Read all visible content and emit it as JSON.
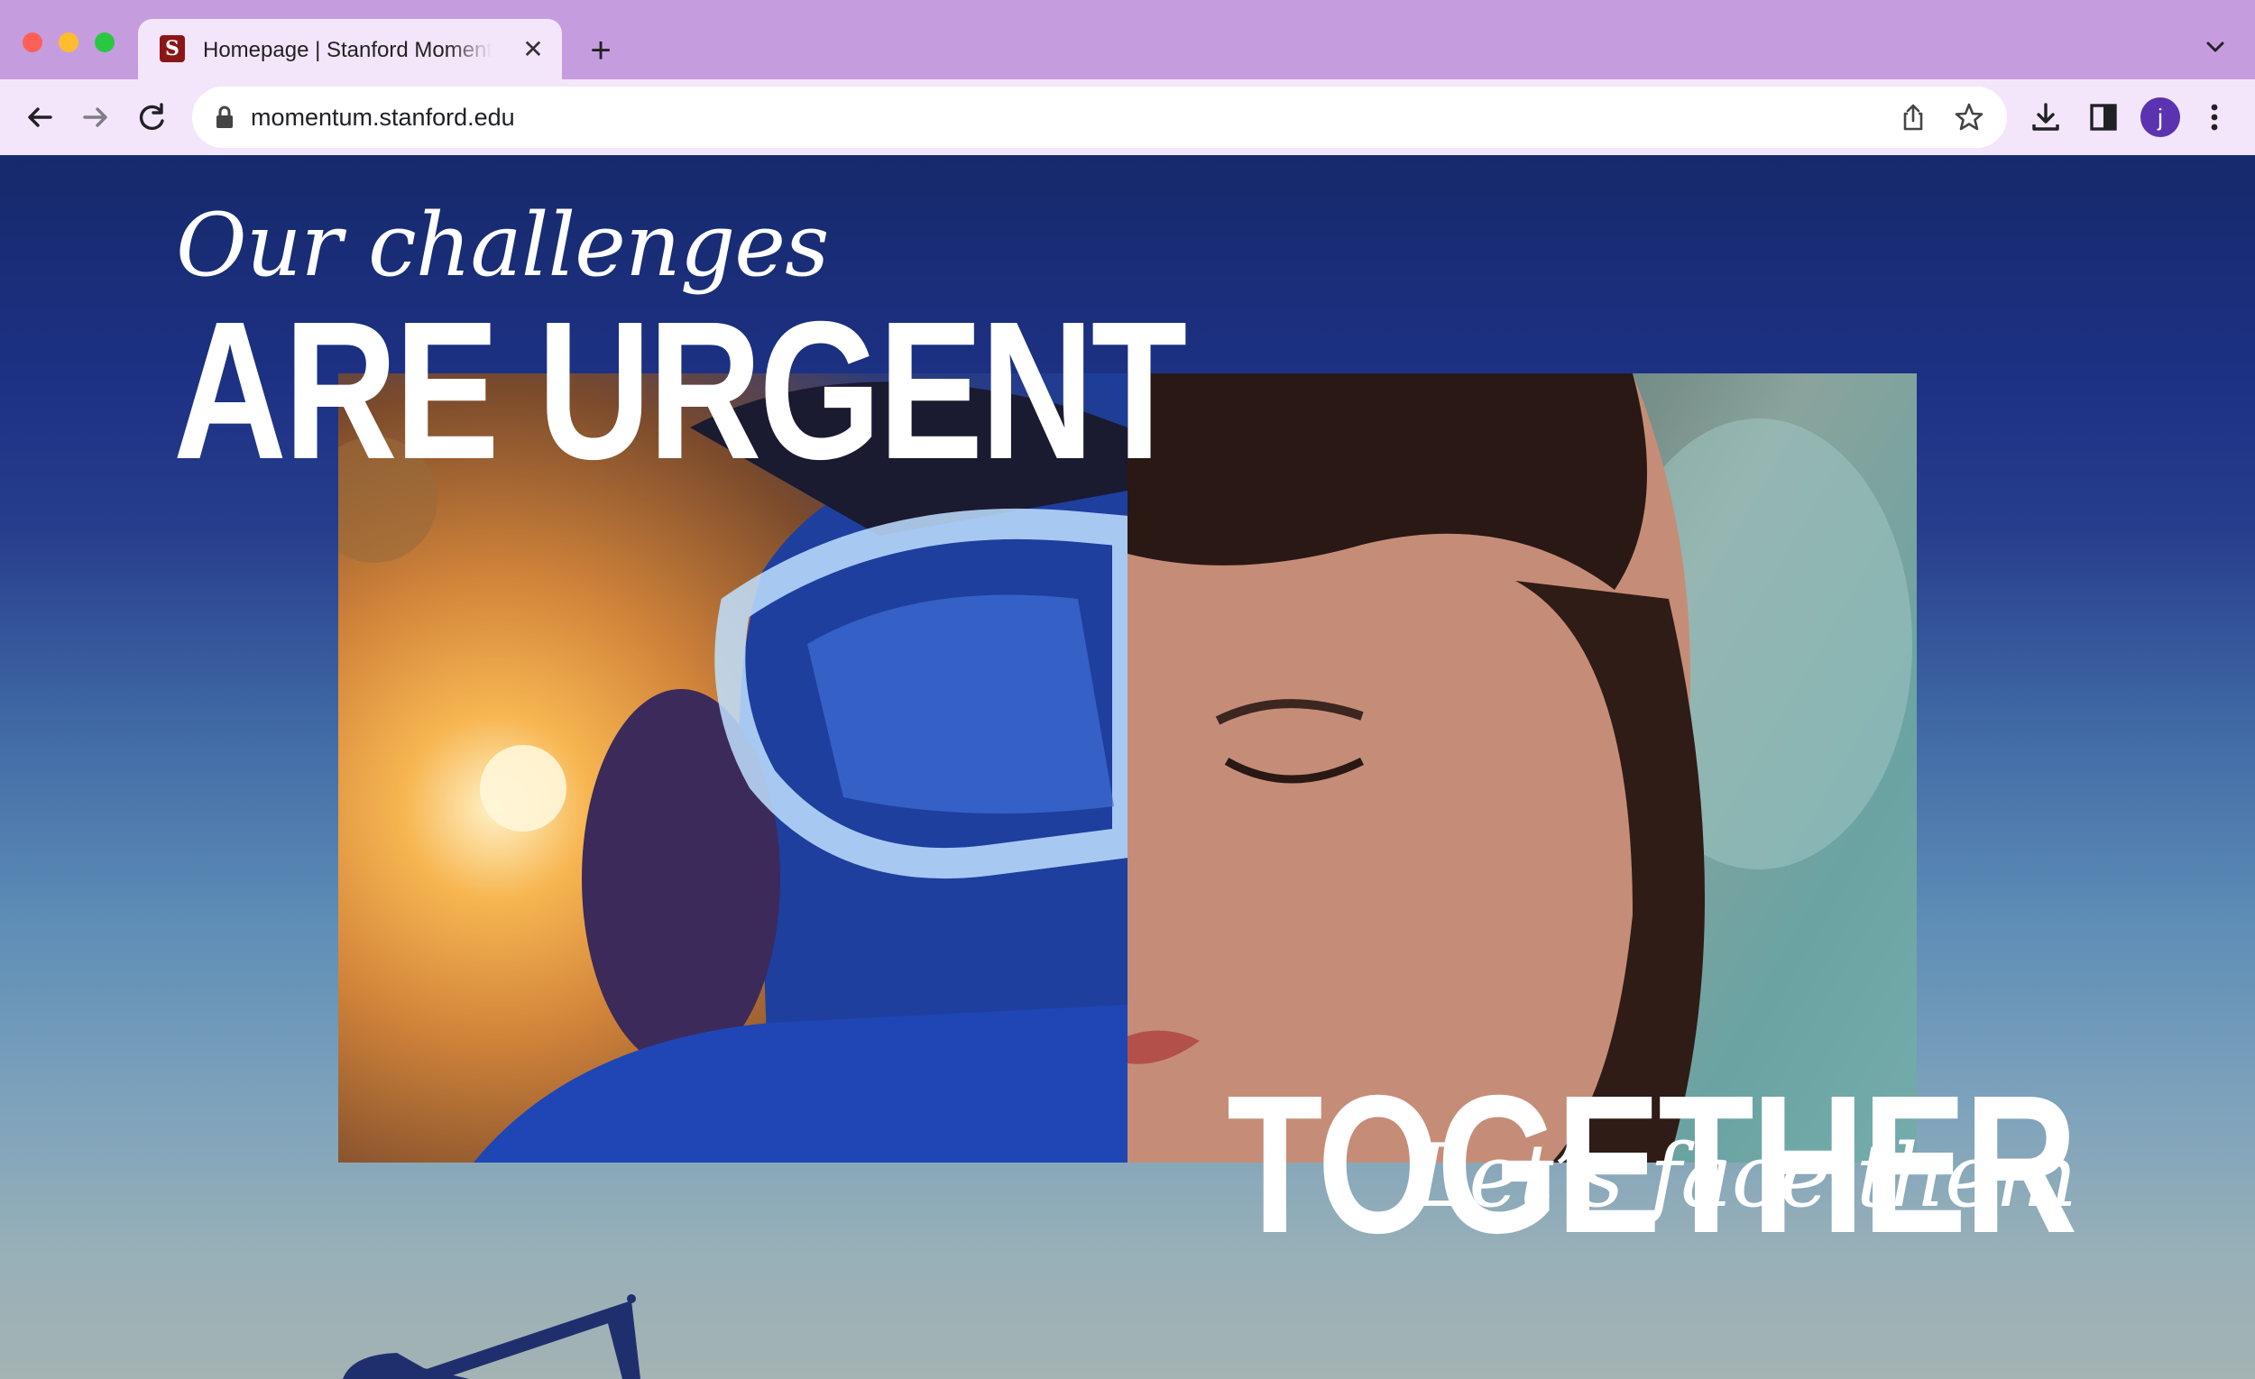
{
  "browser": {
    "tab": {
      "favicon_letter": "S",
      "title": "Homepage | Stanford Momentum",
      "close_glyph": "✕"
    },
    "new_tab_glyph": "+",
    "address_bar": {
      "url": "momentum.stanford.edu",
      "security_icon": "lock-icon"
    },
    "profile_initial": "j",
    "icons": [
      "back-arrow-icon",
      "forward-arrow-icon",
      "reload-icon",
      "share-icon",
      "bookmark-star-icon",
      "download-icon",
      "side-panel-icon",
      "kebab-menu-icon",
      "tab-search-chevron-icon"
    ],
    "colors": {
      "tab_strip": "#c59ddf",
      "toolbar": "#f3e6fb",
      "avatar": "#5b32b0",
      "favicon": "#8c1515"
    }
  },
  "hero": {
    "line1": "Our challenges",
    "line2": "ARE URGENT",
    "line3": "Let’s face them",
    "line4": "TOGETHER",
    "background_colors": {
      "top": "#16296b",
      "bottom": "#a4b3b3"
    }
  }
}
